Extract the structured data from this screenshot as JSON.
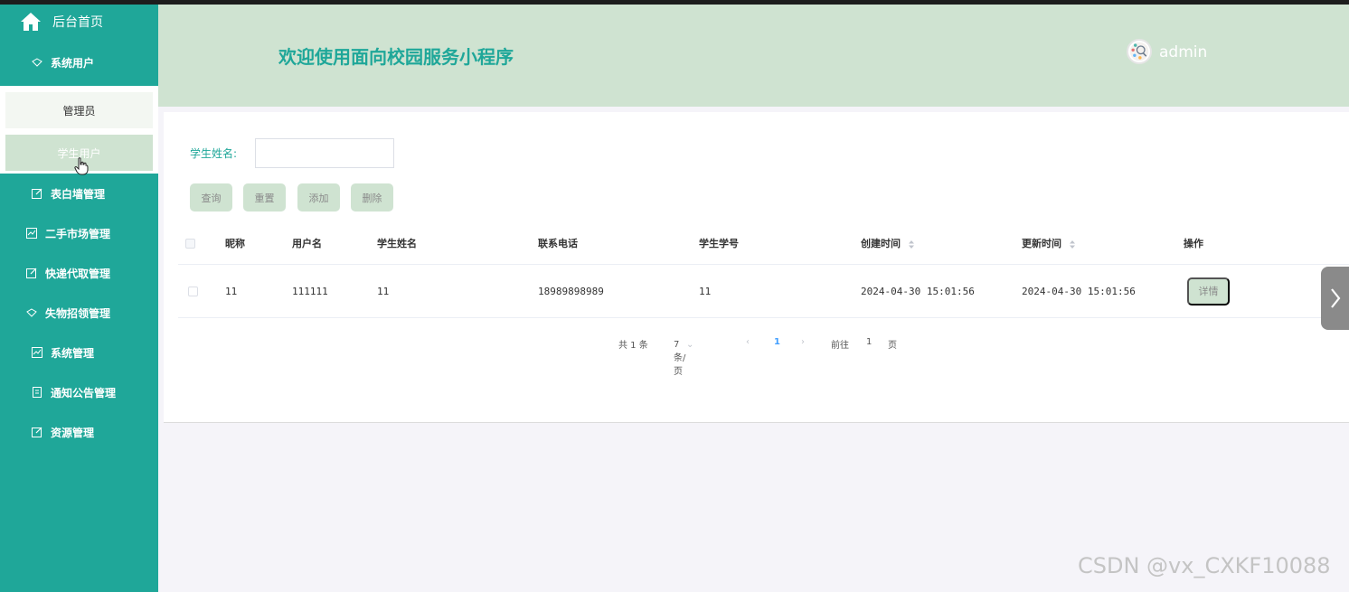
{
  "sidebar": {
    "home_label": "后台首页",
    "system_users_label": "系统用户",
    "submenu": [
      "管理员",
      "学生用户"
    ],
    "items": [
      "表白墙管理",
      "二手市场管理",
      "快递代取管理",
      "失物招领管理",
      "系统管理",
      "通知公告管理",
      "资源管理"
    ]
  },
  "header": {
    "title": "欢迎使用面向校园服务小程序",
    "username": "admin"
  },
  "search": {
    "label": "学生姓名:",
    "value": "",
    "placeholder": ""
  },
  "buttons": {
    "query": "查询",
    "reset": "重置",
    "add": "添加",
    "delete": "删除"
  },
  "table": {
    "columns": [
      "昵称",
      "用户名",
      "学生姓名",
      "联系电话",
      "学生学号",
      "创建时间",
      "更新时间",
      "操作"
    ],
    "rows": [
      {
        "nickname": "11",
        "username": "111111",
        "student_name": "11",
        "phone": "18989898989",
        "student_id": "11",
        "created": "2024-04-30 15:01:56",
        "updated": "2024-04-30 15:01:56",
        "action": "详情"
      }
    ]
  },
  "pagination": {
    "total": "共 1 条",
    "page_size": "7条/页",
    "current_page": "1",
    "goto_label": "前往",
    "goto_value": "1",
    "page_suffix": "页"
  },
  "watermark": "CSDN @vx_CXKF10088",
  "colors": {
    "accent": "#1fa799",
    "header_bg": "#cfe3d1",
    "button_bg": "#cfe3d1"
  }
}
